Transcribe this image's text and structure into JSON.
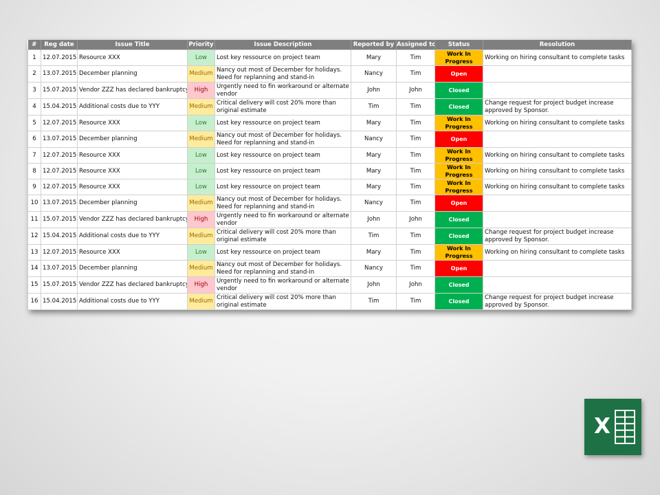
{
  "table": {
    "columns": [
      "#",
      "Reg date",
      "Issue Title",
      "Priority",
      "Issue Description",
      "Reported by",
      "Assigned to",
      "Status",
      "Resolution"
    ],
    "rows": [
      {
        "num": "1",
        "date": "12.07.2015",
        "title": "Resource XXX",
        "priority": "Low",
        "description": "Lost key ressource on project team",
        "reported": "Mary",
        "assigned": "Tim",
        "status": "Work In Progress",
        "resolution": "Working on hiring consultant to complete tasks"
      },
      {
        "num": "2",
        "date": "13.07.2015",
        "title": "December planning",
        "priority": "Medium",
        "description": "Nancy out most of December for holidays. Need for replanning and stand-in",
        "reported": "Nancy",
        "assigned": "Tim",
        "status": "Open",
        "resolution": ""
      },
      {
        "num": "3",
        "date": "15.07.2015",
        "title": "Vendor ZZZ has declared bankruptcy",
        "priority": "High",
        "description": "Urgently need to fin workaround or alternate vendor",
        "reported": "John",
        "assigned": "John",
        "status": "Closed",
        "resolution": ""
      },
      {
        "num": "4",
        "date": "15.04.2015",
        "title": "Additional costs due to YYY",
        "priority": "Medium",
        "description": "Critical delivery will cost 20% more than original estimate",
        "reported": "Tim",
        "assigned": "Tim",
        "status": "Closed",
        "resolution": "Change request for project budget increase approved by Sponsor."
      },
      {
        "num": "5",
        "date": "12.07.2015",
        "title": "Resource XXX",
        "priority": "Low",
        "description": "Lost key ressource on project team",
        "reported": "Mary",
        "assigned": "Tim",
        "status": "Work In Progress",
        "resolution": "Working on hiring consultant to complete tasks"
      },
      {
        "num": "6",
        "date": "13.07.2015",
        "title": "December planning",
        "priority": "Medium",
        "description": "Nancy out most of December for holidays. Need for replanning and stand-in",
        "reported": "Nancy",
        "assigned": "Tim",
        "status": "Open",
        "resolution": ""
      },
      {
        "num": "7",
        "date": "12.07.2015",
        "title": "Resource XXX",
        "priority": "Low",
        "description": "Lost key ressource on project team",
        "reported": "Mary",
        "assigned": "Tim",
        "status": "Work In Progress",
        "resolution": "Working on hiring consultant to complete tasks"
      },
      {
        "num": "8",
        "date": "12.07.2015",
        "title": "Resource XXX",
        "priority": "Low",
        "description": "Lost key ressource on project team",
        "reported": "Mary",
        "assigned": "Tim",
        "status": "Work In Progress",
        "resolution": "Working on hiring consultant to complete tasks"
      },
      {
        "num": "9",
        "date": "12.07.2015",
        "title": "Resource XXX",
        "priority": "Low",
        "description": "Lost key ressource on project team",
        "reported": "Mary",
        "assigned": "Tim",
        "status": "Work In Progress",
        "resolution": "Working on hiring consultant to complete tasks"
      },
      {
        "num": "10",
        "date": "13.07.2015",
        "title": "December planning",
        "priority": "Medium",
        "description": "Nancy out most of December for holidays. Need for replanning and stand-in",
        "reported": "Nancy",
        "assigned": "Tim",
        "status": "Open",
        "resolution": ""
      },
      {
        "num": "11",
        "date": "15.07.2015",
        "title": "Vendor ZZZ has declared bankruptcy",
        "priority": "High",
        "description": "Urgently need to fin workaround or alternate vendor",
        "reported": "John",
        "assigned": "John",
        "status": "Closed",
        "resolution": ""
      },
      {
        "num": "12",
        "date": "15.04.2015",
        "title": "Additional costs due to YYY",
        "priority": "Medium",
        "description": "Critical delivery will cost 20% more than original estimate",
        "reported": "Tim",
        "assigned": "Tim",
        "status": "Closed",
        "resolution": "Change request for project budget increase approved by Sponsor."
      },
      {
        "num": "13",
        "date": "12.07.2015",
        "title": "Resource XXX",
        "priority": "Low",
        "description": "Lost key ressource on project team",
        "reported": "Mary",
        "assigned": "Tim",
        "status": "Work In Progress",
        "resolution": "Working on hiring consultant to complete tasks"
      },
      {
        "num": "14",
        "date": "13.07.2015",
        "title": "December planning",
        "priority": "Medium",
        "description": "Nancy out most of December for holidays. Need for replanning and stand-in",
        "reported": "Nancy",
        "assigned": "Tim",
        "status": "Open",
        "resolution": ""
      },
      {
        "num": "15",
        "date": "15.07.2015",
        "title": "Vendor ZZZ has declared bankruptcy",
        "priority": "High",
        "description": "Urgently need to fin workaround or alternate vendor",
        "reported": "John",
        "assigned": "John",
        "status": "Closed",
        "resolution": ""
      },
      {
        "num": "16",
        "date": "15.04.2015",
        "title": "Additional costs due to YYY",
        "priority": "Medium",
        "description": "Critical delivery will cost 20% more than original estimate",
        "reported": "Tim",
        "assigned": "Tim",
        "status": "Closed",
        "resolution": "Change request for project budget increase approved by Sponsor."
      }
    ]
  },
  "colors": {
    "header_bg": "#7f7f7f",
    "priority_low": "#c6efce",
    "priority_medium": "#ffeb9c",
    "priority_high": "#ffc7ce",
    "status_wip": "#ffc000",
    "status_open": "#ff0000",
    "status_closed": "#00b050",
    "excel_green": "#1e7145"
  },
  "logo": {
    "icon": "excel-icon",
    "letter": "X"
  }
}
